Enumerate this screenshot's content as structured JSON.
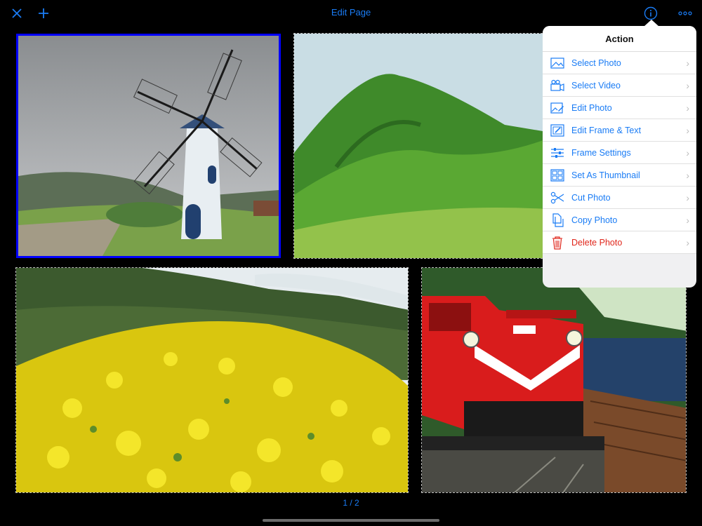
{
  "header": {
    "title": "Edit Page"
  },
  "toolbar": {
    "close_icon": "close-icon",
    "add_icon": "plus-icon",
    "info_icon": "info-icon",
    "more_icon": "more-icon"
  },
  "popover": {
    "title": "Action",
    "items": [
      {
        "label": "Select Photo",
        "icon": "photo-icon"
      },
      {
        "label": "Select Video",
        "icon": "video-camera-icon"
      },
      {
        "label": "Edit Photo",
        "icon": "edit-photo-icon"
      },
      {
        "label": "Edit Frame & Text",
        "icon": "edit-frame-icon"
      },
      {
        "label": "Frame Settings",
        "icon": "sliders-icon"
      },
      {
        "label": "Set As Thumbnail",
        "icon": "thumbnail-icon"
      },
      {
        "label": "Cut Photo",
        "icon": "scissors-icon"
      },
      {
        "label": "Copy Photo",
        "icon": "copy-icon"
      },
      {
        "label": "Delete Photo",
        "icon": "trash-icon"
      }
    ]
  },
  "photos": [
    {
      "name": "windmill",
      "selected": true
    },
    {
      "name": "green-hills",
      "selected": false
    },
    {
      "name": "yellow-flower-field",
      "selected": false
    },
    {
      "name": "red-train",
      "selected": false
    }
  ],
  "pagination": {
    "indicator": "1 / 2"
  },
  "colors": {
    "accent": "#1a7cf5",
    "selection": "#0000ff",
    "danger": "#e0261b",
    "background": "#000000"
  }
}
